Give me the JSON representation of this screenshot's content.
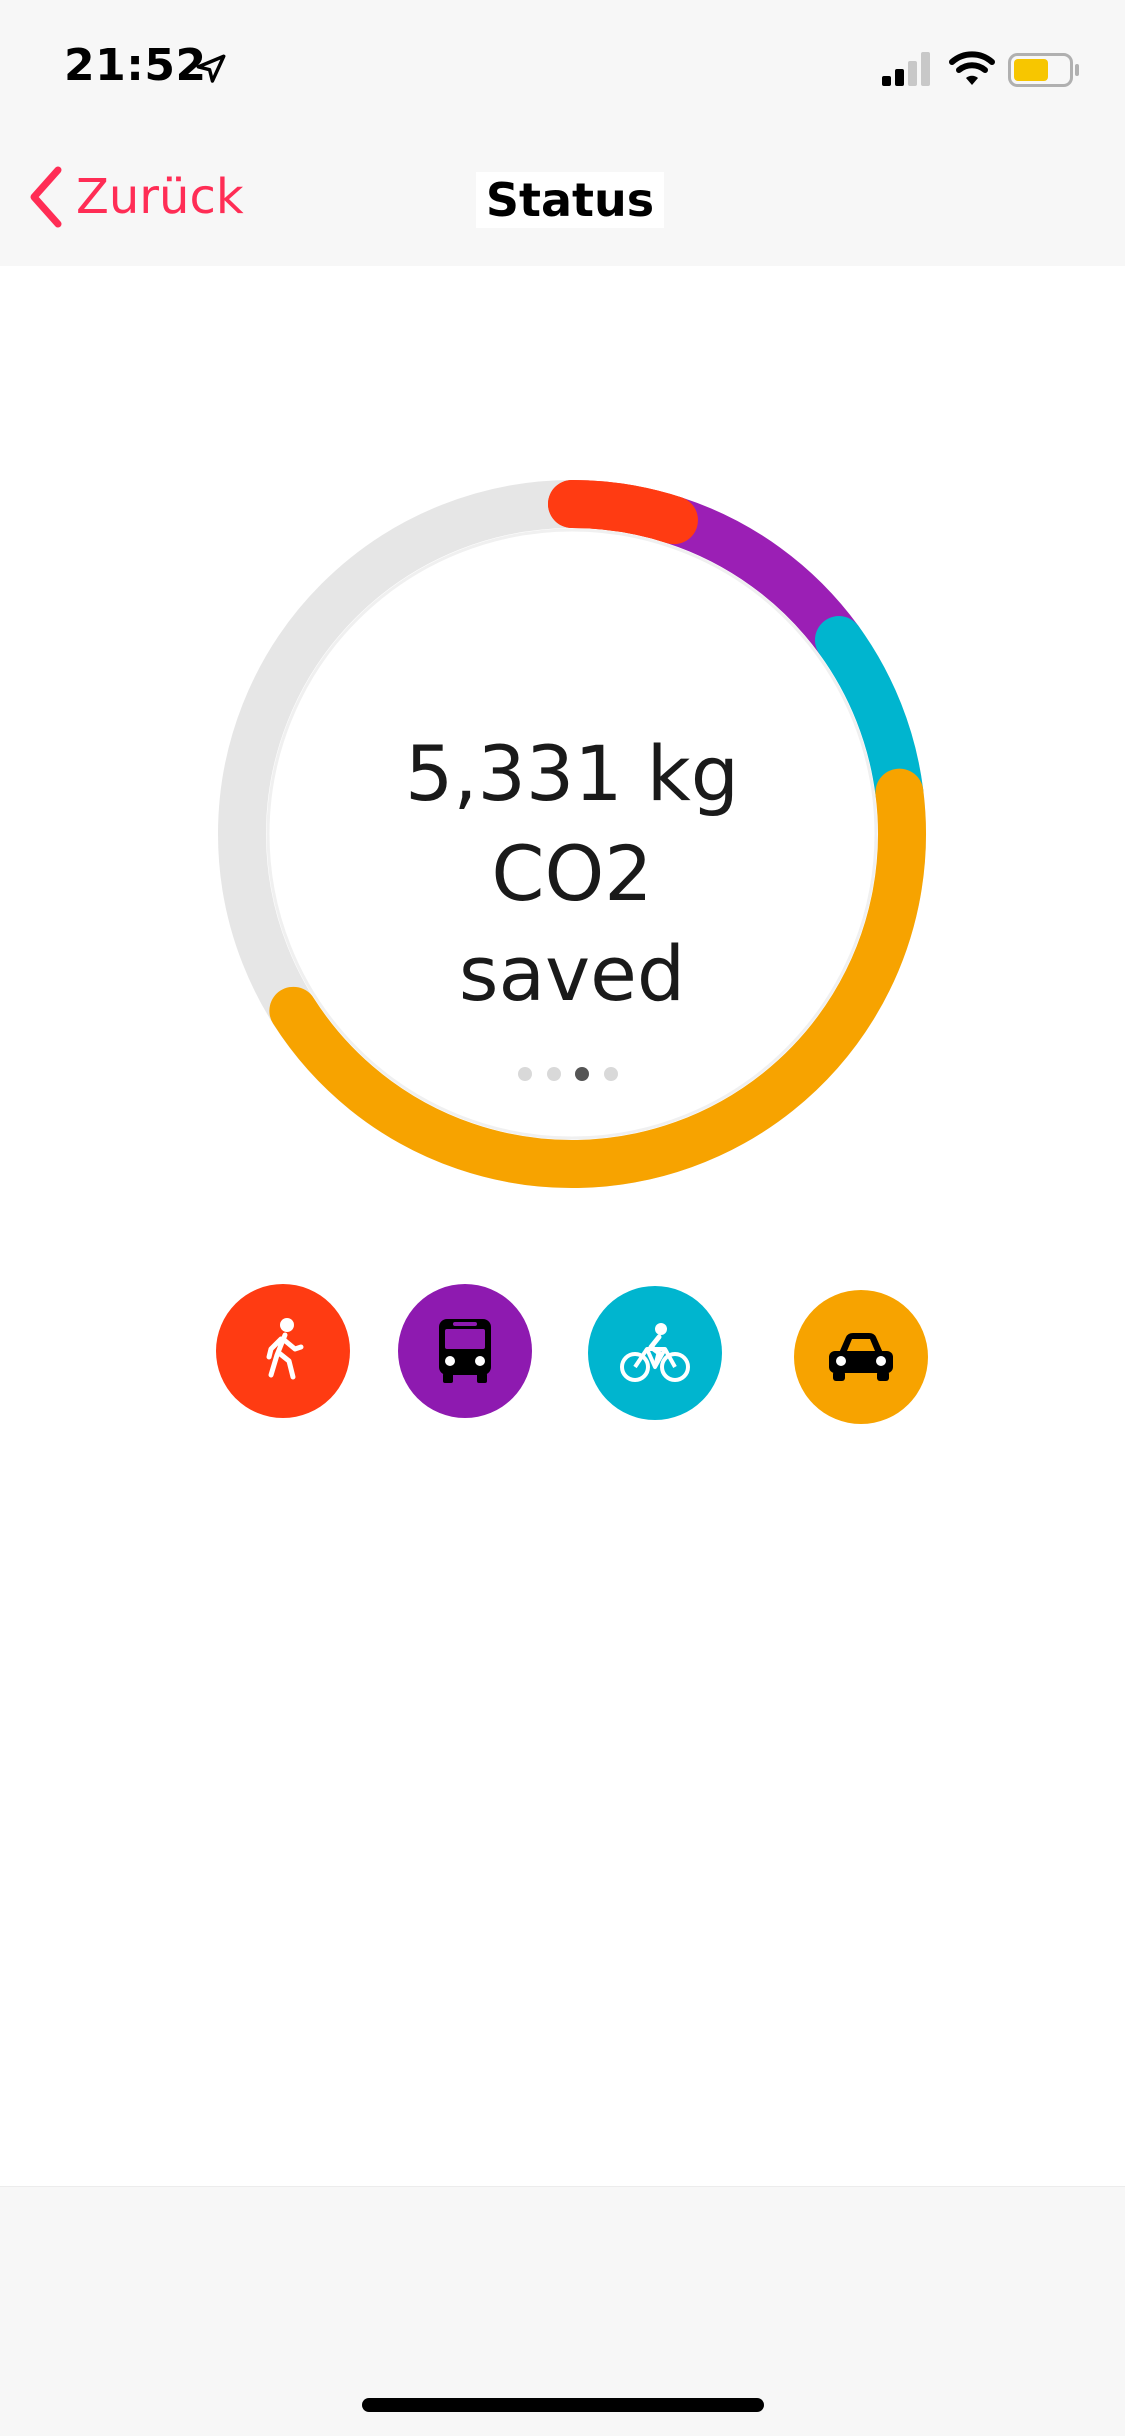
{
  "status_bar": {
    "time": "21:52",
    "battery_color": "#f7c600"
  },
  "nav": {
    "back_label": "Zurück",
    "title": "Status",
    "accent_color": "#ff2d55"
  },
  "summary": {
    "line1": "5,331 kg CO2",
    "line2": "saved"
  },
  "pager": {
    "count": 4,
    "active_index": 2
  },
  "ring_segments": [
    {
      "mode": "walk",
      "color": "#ff3b12",
      "fraction": 0.05
    },
    {
      "mode": "bus",
      "color": "#9b1fb5",
      "fraction": 0.1
    },
    {
      "mode": "bike",
      "color": "#00b5cf",
      "fraction": 0.08
    },
    {
      "mode": "car",
      "color": "#f7a300",
      "fraction": 0.43
    },
    {
      "mode": "remaining",
      "color": "#e6e6e6",
      "fraction": 0.34
    }
  ],
  "modes": [
    {
      "id": "walk",
      "icon": "walking-person-icon",
      "color": "#ff3b12"
    },
    {
      "id": "bus",
      "icon": "bus-icon",
      "color": "#8e1ab0"
    },
    {
      "id": "bike",
      "icon": "bicycle-icon",
      "color": "#00b5cf"
    },
    {
      "id": "car",
      "icon": "car-icon",
      "color": "#f7a300"
    }
  ]
}
